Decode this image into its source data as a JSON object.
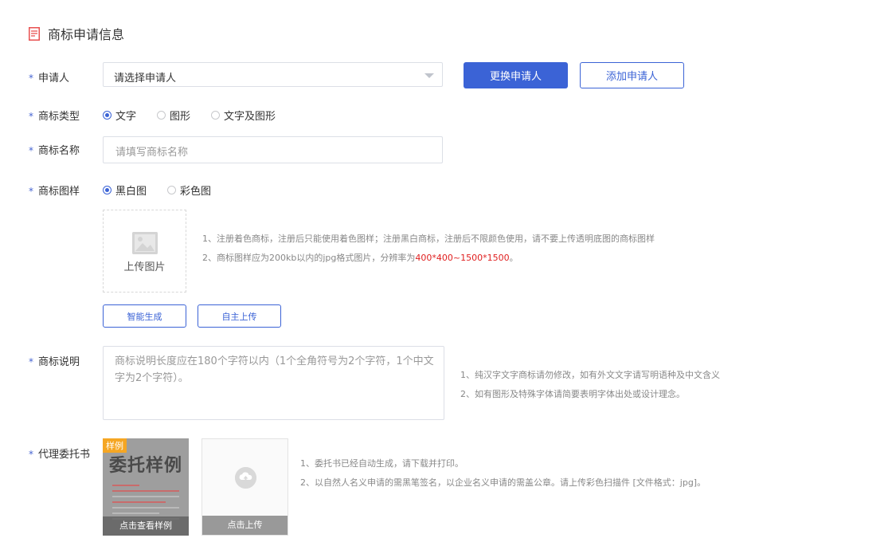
{
  "section": {
    "title": "商标申请信息",
    "icon": "document-icon",
    "accent": "#e85050"
  },
  "applicant": {
    "label": "申请人",
    "select_value": "请选择申请人",
    "change_button": "更换申请人",
    "add_button": "添加申请人"
  },
  "type": {
    "label": "商标类型",
    "options": [
      "文字",
      "图形",
      "文字及图形"
    ],
    "selected": "文字"
  },
  "name": {
    "label": "商标名称",
    "placeholder": "请填写商标名称"
  },
  "image": {
    "label": "商标图样",
    "options": [
      "黑白图",
      "彩色图"
    ],
    "selected": "黑白图",
    "upload_label": "上传图片",
    "hint1": "1、注册着色商标，注册后只能使用着色图样；注册黑白商标，注册后不限颜色使用，请不要上传透明底图的商标图样",
    "hint2_prefix": "2、商标图样应为200kb以内的jpg格式图片，分辨率为",
    "hint2_red": "400*400~1500*1500",
    "hint2_suffix": "。",
    "smart_button": "智能生成",
    "self_button": "自主上传"
  },
  "description": {
    "label": "商标说明",
    "placeholder": "商标说明长度应在180个字符以内（1个全角符号为2个字符，1个中文字为2个字符）。",
    "hint1": "1、纯汉字文字商标请勿修改，如有外文文字请写明语种及中文含义",
    "hint2": "2、如有图形及特殊字体请简要表明字体出处或设计理念。"
  },
  "proxy": {
    "label": "代理委托书",
    "sample_tag": "样例",
    "sample_title": "委托样例",
    "sample_caption": "点击查看样例",
    "upload_caption": "点击上传",
    "hint1": "1、委托书已经自动生成，请下载并打印。",
    "hint2": "2、以自然人名义申请的需黑笔签名，以企业名义申请的需盖公章。请上传彩色扫描件 [文件格式：jpg]。"
  },
  "required_mark": "*",
  "colors": {
    "primary": "#3b63d6",
    "red": "#e02020",
    "tag": "#f5a623"
  }
}
